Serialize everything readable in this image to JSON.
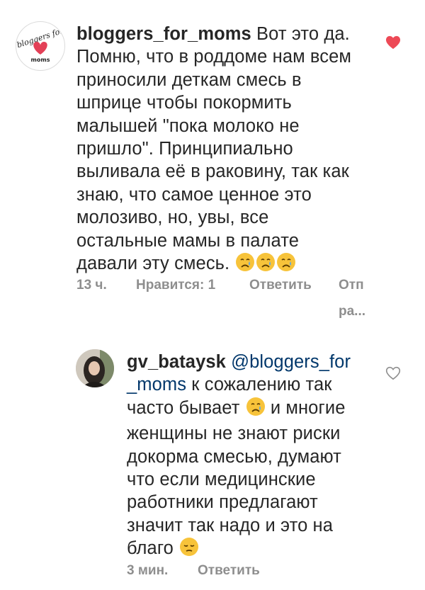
{
  "comments": [
    {
      "username": "bloggers_for_moms",
      "avatar_text_top": "bloggers for",
      "avatar_text_bottom": "moms",
      "text": "Вот это да. Помню, что в роддоме нам всем приносили деткам смесь в шприце чтобы покормить малышей \"пока молоко не пришло\". Принципиально выливала её в раковину, так как знаю, что самое ценное это молозиво, но, увы, все остальные мамы в палате давали эту смесь.",
      "emoji": [
        "crying-face",
        "crying-face",
        "crying-face"
      ],
      "liked": true,
      "time": "13 ч.",
      "likes": "Нравится: 1",
      "reply_label": "Ответить",
      "more_line1": "Отп",
      "more_line2": "ра..."
    }
  ],
  "reply": {
    "username": "gv_bataysk",
    "mention": "@bloggers_for _moms",
    "text_part1": "к сожалению так часто бывает",
    "emoji1": "crying-face",
    "text_part2": "и многие женщины не знают риски докорма смесью, думают что если медицинские работники предлагают значит так надо и это на благо",
    "emoji2": "pensive-face",
    "liked": false,
    "time": "3 мин.",
    "reply_label": "Ответить"
  },
  "colors": {
    "text": "#262626",
    "meta": "#8e8e8e",
    "mention": "#00376b",
    "heart_filled": "#ed4956"
  }
}
